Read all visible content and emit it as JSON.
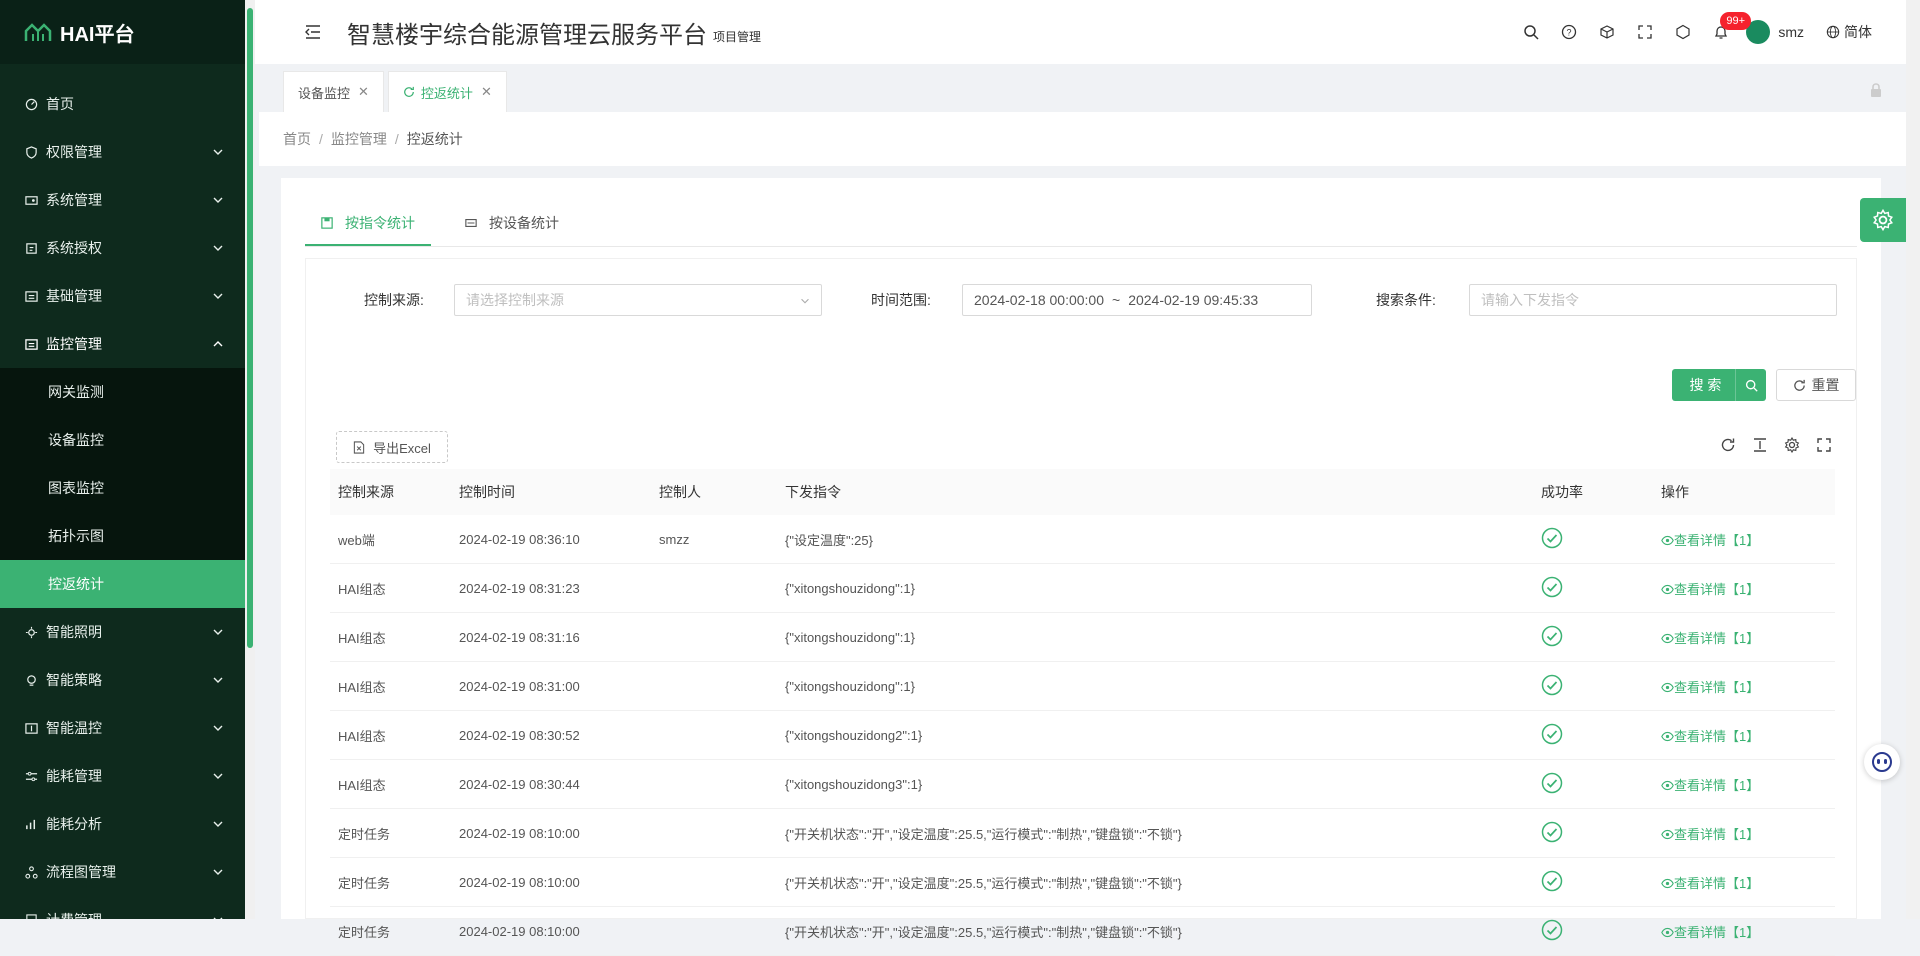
{
  "app": {
    "logo_text": "HAI平台",
    "title": "智慧楼宇综合能源管理云服务平台",
    "subtitle": "项目管理",
    "user_name": "smz",
    "language": "简体",
    "notification_badge": "99+"
  },
  "sidebar": {
    "items": [
      {
        "label": "首页",
        "icon": "dashboard-icon"
      },
      {
        "label": "权限管理",
        "icon": "shield-icon"
      },
      {
        "label": "系统管理",
        "icon": "system-icon"
      },
      {
        "label": "系统授权",
        "icon": "auth-icon"
      },
      {
        "label": "基础管理",
        "icon": "base-icon"
      },
      {
        "label": "监控管理",
        "icon": "monitor-icon"
      },
      {
        "label": "智能照明",
        "icon": "light-icon"
      },
      {
        "label": "智能策略",
        "icon": "bulb-icon"
      },
      {
        "label": "智能温控",
        "icon": "temp-icon"
      },
      {
        "label": "能耗管理",
        "icon": "sliders-icon"
      },
      {
        "label": "能耗分析",
        "icon": "chart-icon"
      },
      {
        "label": "流程图管理",
        "icon": "flow-icon"
      },
      {
        "label": "计费管理",
        "icon": "bill-icon"
      }
    ],
    "sub_items": [
      "网关监测",
      "设备监控",
      "图表监控",
      "拓扑示图",
      "控返统计"
    ]
  },
  "tabs": [
    {
      "label": "设备监控"
    },
    {
      "label": "控返统计"
    }
  ],
  "breadcrumb": [
    "首页",
    "监控管理",
    "控返统计"
  ],
  "inner_tabs": [
    "按指令统计",
    "按设备统计"
  ],
  "filters": {
    "source_label": "控制来源:",
    "source_placeholder": "请选择控制来源",
    "time_label": "时间范围:",
    "time_start": "2024-02-18 00:00:00",
    "time_sep": "~",
    "time_end": "2024-02-19 09:45:33",
    "search_label": "搜索条件:",
    "search_placeholder": "请输入下发指令",
    "search_button": "搜 索",
    "reset_button": "重置"
  },
  "toolbar": {
    "export_label": "导出Excel"
  },
  "table": {
    "columns": [
      "控制来源",
      "控制时间",
      "控制人",
      "下发指令",
      "成功率",
      "操作"
    ],
    "rows": [
      [
        "web端",
        "2024-02-19 08:36:10",
        "smzz",
        "{\"设定温度\":25}",
        "ok",
        "查看详情【1】"
      ],
      [
        "HAI组态",
        "2024-02-19 08:31:23",
        "",
        "{\"xitongshouzidong\":1}",
        "ok",
        "查看详情【1】"
      ],
      [
        "HAI组态",
        "2024-02-19 08:31:16",
        "",
        "{\"xitongshouzidong\":1}",
        "ok",
        "查看详情【1】"
      ],
      [
        "HAI组态",
        "2024-02-19 08:31:00",
        "",
        "{\"xitongshouzidong\":1}",
        "ok",
        "查看详情【1】"
      ],
      [
        "HAI组态",
        "2024-02-19 08:30:52",
        "",
        "{\"xitongshouzidong2\":1}",
        "ok",
        "查看详情【1】"
      ],
      [
        "HAI组态",
        "2024-02-19 08:30:44",
        "",
        "{\"xitongshouzidong3\":1}",
        "ok",
        "查看详情【1】"
      ],
      [
        "定时任务",
        "2024-02-19 08:10:00",
        "",
        "{\"开关机状态\":\"开\",\"设定温度\":25.5,\"运行模式\":\"制热\",\"键盘锁\":\"不锁\"}",
        "ok",
        "查看详情【1】"
      ],
      [
        "定时任务",
        "2024-02-19 08:10:00",
        "",
        "{\"开关机状态\":\"开\",\"设定温度\":25.5,\"运行模式\":\"制热\",\"键盘锁\":\"不锁\"}",
        "ok",
        "查看详情【1】"
      ],
      [
        "定时任务",
        "2024-02-19 08:10:00",
        "",
        "{\"开关机状态\":\"开\",\"设定温度\":25.5,\"运行模式\":\"制热\",\"键盘锁\":\"不锁\"}",
        "ok",
        "查看详情【1】"
      ]
    ]
  },
  "colors": {
    "accent": "#3bb273",
    "sidebar_bg": "#0e2a1d",
    "badge": "#f5222d"
  }
}
